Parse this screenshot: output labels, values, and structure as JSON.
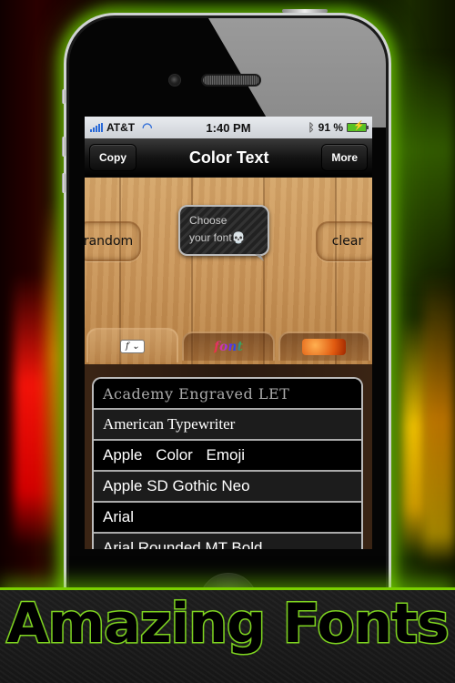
{
  "status_bar": {
    "carrier": "AT&T",
    "time": "1:40 PM",
    "battery_percent": "91 %",
    "icons": [
      "signal-icon",
      "wifi-icon",
      "bluetooth-icon",
      "battery-charging-icon"
    ]
  },
  "nav": {
    "left_button": "Copy",
    "title": "Color Text",
    "right_button": "More"
  },
  "editor": {
    "random_button": "random",
    "clear_button": "clear",
    "bubble_line1": "Choose",
    "bubble_line2": "your font",
    "bubble_icon": "💀"
  },
  "tabs": [
    {
      "id": "font-family",
      "label": "f",
      "chevron": "⌄",
      "active": true
    },
    {
      "id": "font-color",
      "label": "font",
      "active": false
    },
    {
      "id": "texture",
      "label": "",
      "active": false
    }
  ],
  "font_list": [
    "Academy Engraved LET",
    "American Typewriter",
    "Apple Color Emoji",
    "Apple SD Gothic Neo",
    "Arial",
    "Arial Rounded MT Bold"
  ],
  "banner": {
    "title": "Amazing Fonts",
    "accent_color": "#7ed321"
  }
}
